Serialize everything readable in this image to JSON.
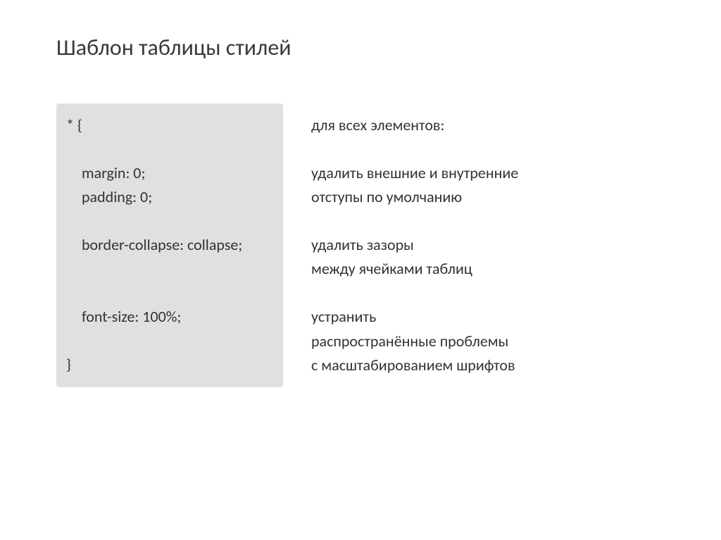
{
  "title": "Шаблон таблицы стилей",
  "code": {
    "open": "*  {",
    "margin": "margin: 0;",
    "padding": "padding: 0;",
    "border": "border-collapse: collapse;",
    "font": "font-size: 100%;",
    "close": "}"
  },
  "explain": {
    "all": "для всех элементов:",
    "remove1": "удалить внешние и внутренние",
    "remove2": "отступы по умолчанию",
    "gap1": "удалить зазоры",
    "gap2": "между ячейками таблиц",
    "font1": "устранить",
    "font2": "распространённые проблемы",
    "font3": "с масштабированием шрифтов"
  }
}
